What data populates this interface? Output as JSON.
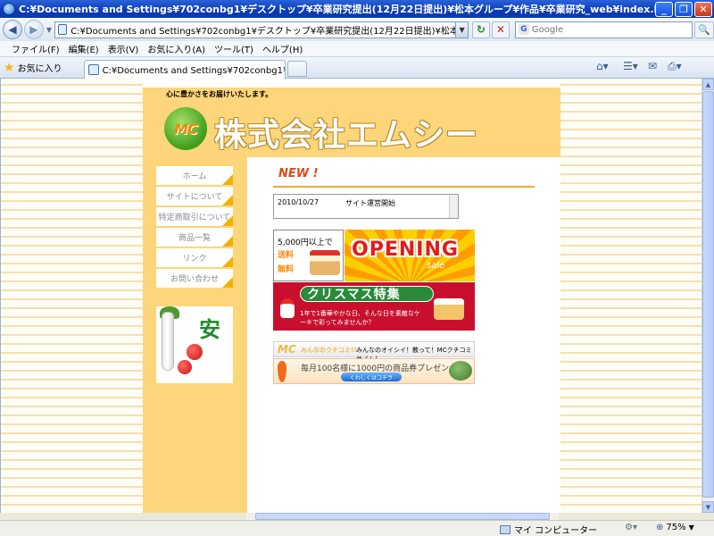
{
  "window": {
    "title": "C:¥Documents and Settings¥702conbg1¥デスクトップ¥卒業研究提出(12月22日提出)¥松本グループ¥作品¥卒業研究_web¥index.html - Windows Inte..."
  },
  "address_bar": {
    "url": "C:¥Documents and Settings¥702conbg1¥デスクトップ¥卒業研究提出(12月22日提出)¥松本グループ¥作品¥卒業",
    "search_placeholder": "Google"
  },
  "menu": [
    "ファイル(F)",
    "編集(E)",
    "表示(V)",
    "お気に入り(A)",
    "ツール(T)",
    "ヘルプ(H)"
  ],
  "favorites_label": "お気に入り",
  "tab": {
    "title": "C:¥Documents and Settings¥702conbg1¥デスクトップ..."
  },
  "site": {
    "tagline": "心に豊かさをお届けいたします。",
    "logo_text": "MC",
    "company_name": "株式会社エムシー",
    "nav": [
      "ホーム",
      "サイトについて",
      "特定商取引について",
      "商品一覧",
      "リンク",
      "お問い合わせ"
    ],
    "ad_kanji": "安",
    "news_heading": "NEW !",
    "news": [
      {
        "date": "2010/10/27",
        "text": "サイト運営開始"
      }
    ],
    "banners": {
      "shipping": {
        "line1": "5,000円以上で",
        "line2": "送料",
        "line3": "無料"
      },
      "opening": {
        "main": "OPENING",
        "sub": "sale"
      },
      "christmas": {
        "title": "クリスマス特集",
        "sub": "1年で1番華やかな日、そんな日を素敵なケーキで彩ってみませんか？"
      },
      "kuchikomi": {
        "logo": "MC",
        "title": "みんなのクチコミ!!",
        "text": "みんなのオイシイ！教って！MCクチコミサイト！"
      },
      "present": {
        "text": "毎月100名様に1000円の商品券プレゼント！",
        "button": "くわしくはコチラ"
      }
    }
  },
  "status_bar": {
    "zone": "マイ コンピューター",
    "zoom": "75%"
  }
}
